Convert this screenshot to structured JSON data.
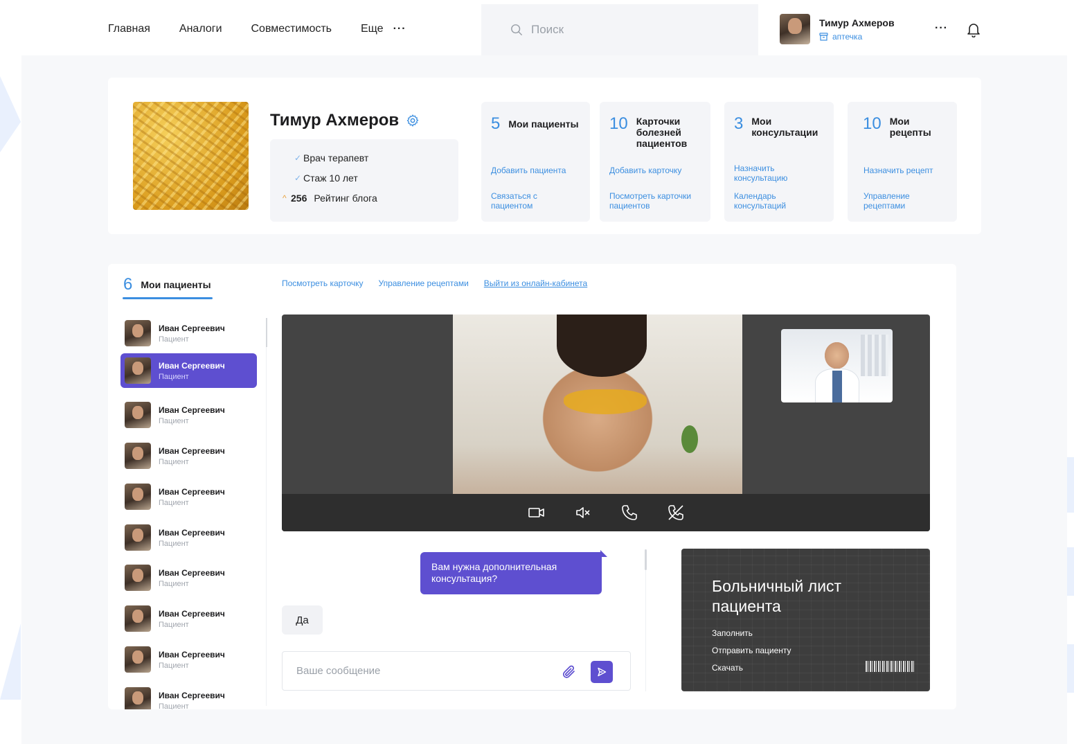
{
  "nav": {
    "items": [
      "Главная",
      "Аналоги",
      "Совместимость",
      "Еще"
    ],
    "more_dots": "···"
  },
  "search": {
    "placeholder": "Поиск"
  },
  "user": {
    "name": "Тимур Ахмеров",
    "role": "аптечка"
  },
  "profile": {
    "name": "Тимур Ахмеров",
    "facts": [
      {
        "text": "Врач терапевт"
      },
      {
        "text": "Стаж 10 лет"
      },
      {
        "number": "256",
        "text": "Рейтинг блога"
      }
    ]
  },
  "stats": [
    {
      "count": "5",
      "label": "Мои пациенты",
      "links": [
        "Добавить пациента",
        "Связаться с пациентом"
      ]
    },
    {
      "count": "10",
      "label": "Карточки болезней пациентов",
      "links": [
        "Добавить карточку",
        "Посмотреть карточки пациентов"
      ]
    },
    {
      "count": "3",
      "label": "Мои консультации",
      "links": [
        "Назначить консультацию",
        "Календарь консультаций"
      ]
    },
    {
      "count": "10",
      "label": "Мои рецепты",
      "links": [
        "Назначить рецепт",
        "Управление рецептами"
      ]
    }
  ],
  "patients": {
    "count": "6",
    "title": "Мои пациенты",
    "active_index": 1,
    "items": [
      {
        "name": "Иван Сергеевич",
        "role": "Пациент"
      },
      {
        "name": "Иван Сергеевич",
        "role": "Пациент"
      },
      {
        "name": "Иван Сергеевич",
        "role": "Пациент"
      },
      {
        "name": "Иван Сергеевич",
        "role": "Пациент"
      },
      {
        "name": "Иван Сергеевич",
        "role": "Пациент"
      },
      {
        "name": "Иван Сергеевич",
        "role": "Пациент"
      },
      {
        "name": "Иван Сергеевич",
        "role": "Пациент"
      },
      {
        "name": "Иван Сергеевич",
        "role": "Пациент"
      },
      {
        "name": "Иван Сергеевич",
        "role": "Пациент"
      },
      {
        "name": "Иван Сергеевич",
        "role": "Пациент"
      }
    ]
  },
  "links": [
    "Посмотреть карточку",
    "Управление рецептами",
    "Выйти из онлайн-кабинета"
  ],
  "chat": {
    "outgoing": "Вам нужна дополнительная консультация?",
    "incoming": "Да",
    "input_placeholder": "Ваше сообщение"
  },
  "sick_leave": {
    "title": "Больничный лист пациента",
    "actions": [
      "Заполнить",
      "Отправить пациенту",
      "Скачать"
    ]
  },
  "colors": {
    "accent_blue": "#3b8ee0",
    "accent_purple": "#5e4fd0",
    "video_bg": "#444444",
    "page_bg": "#f7f8fa"
  },
  "icons": [
    "search-icon",
    "store-icon",
    "bell-icon",
    "gear-icon",
    "check-icon",
    "arrow-up-icon",
    "camera-icon",
    "mute-icon",
    "phone-icon",
    "hangup-icon",
    "paperclip-icon",
    "send-icon"
  ]
}
